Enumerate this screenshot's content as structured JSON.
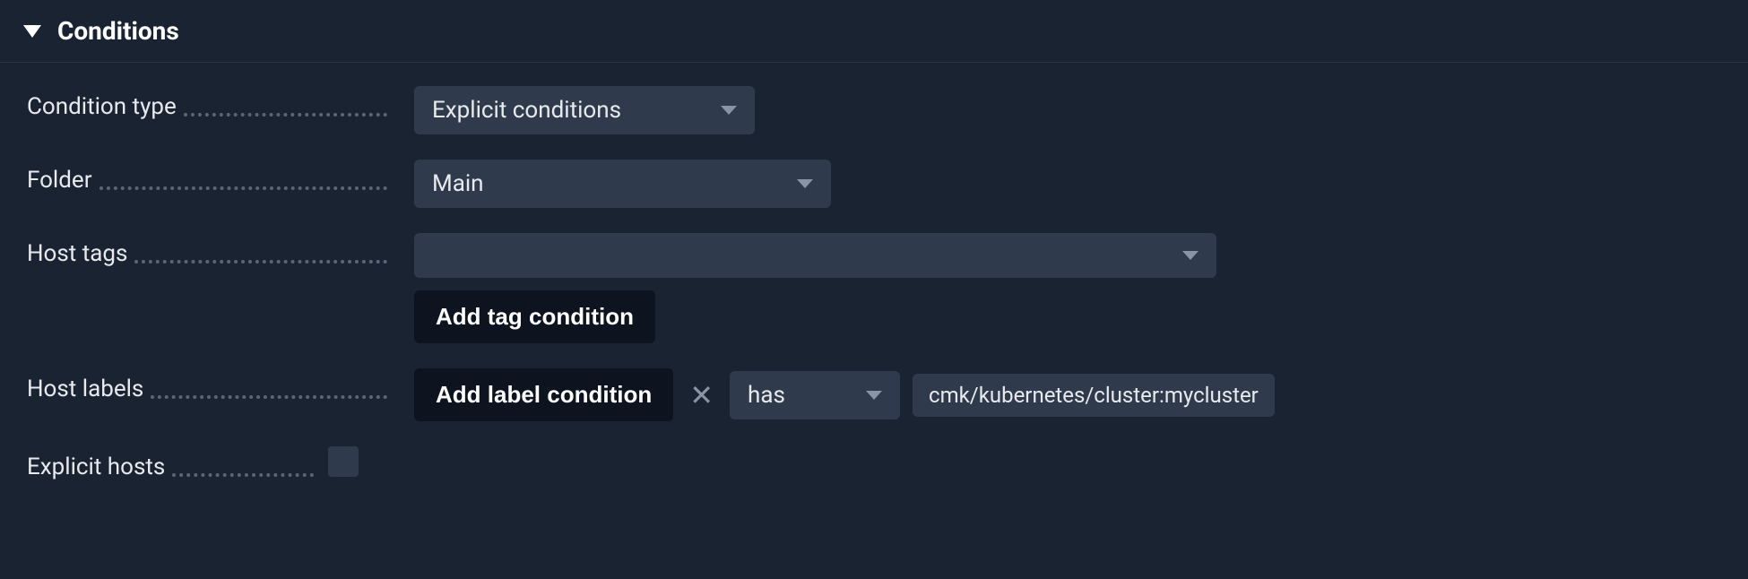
{
  "section": {
    "title": "Conditions"
  },
  "labels": {
    "condition_type": "Condition type",
    "folder": "Folder",
    "host_tags": "Host tags",
    "host_labels": "Host labels",
    "explicit_hosts": "Explicit hosts"
  },
  "values": {
    "condition_type": "Explicit conditions",
    "folder": "Main",
    "host_tags": "",
    "label_operator": "has",
    "label_value": "cmk/kubernetes/cluster:mycluster"
  },
  "buttons": {
    "add_tag_condition": "Add tag condition",
    "add_label_condition": "Add label condition"
  }
}
